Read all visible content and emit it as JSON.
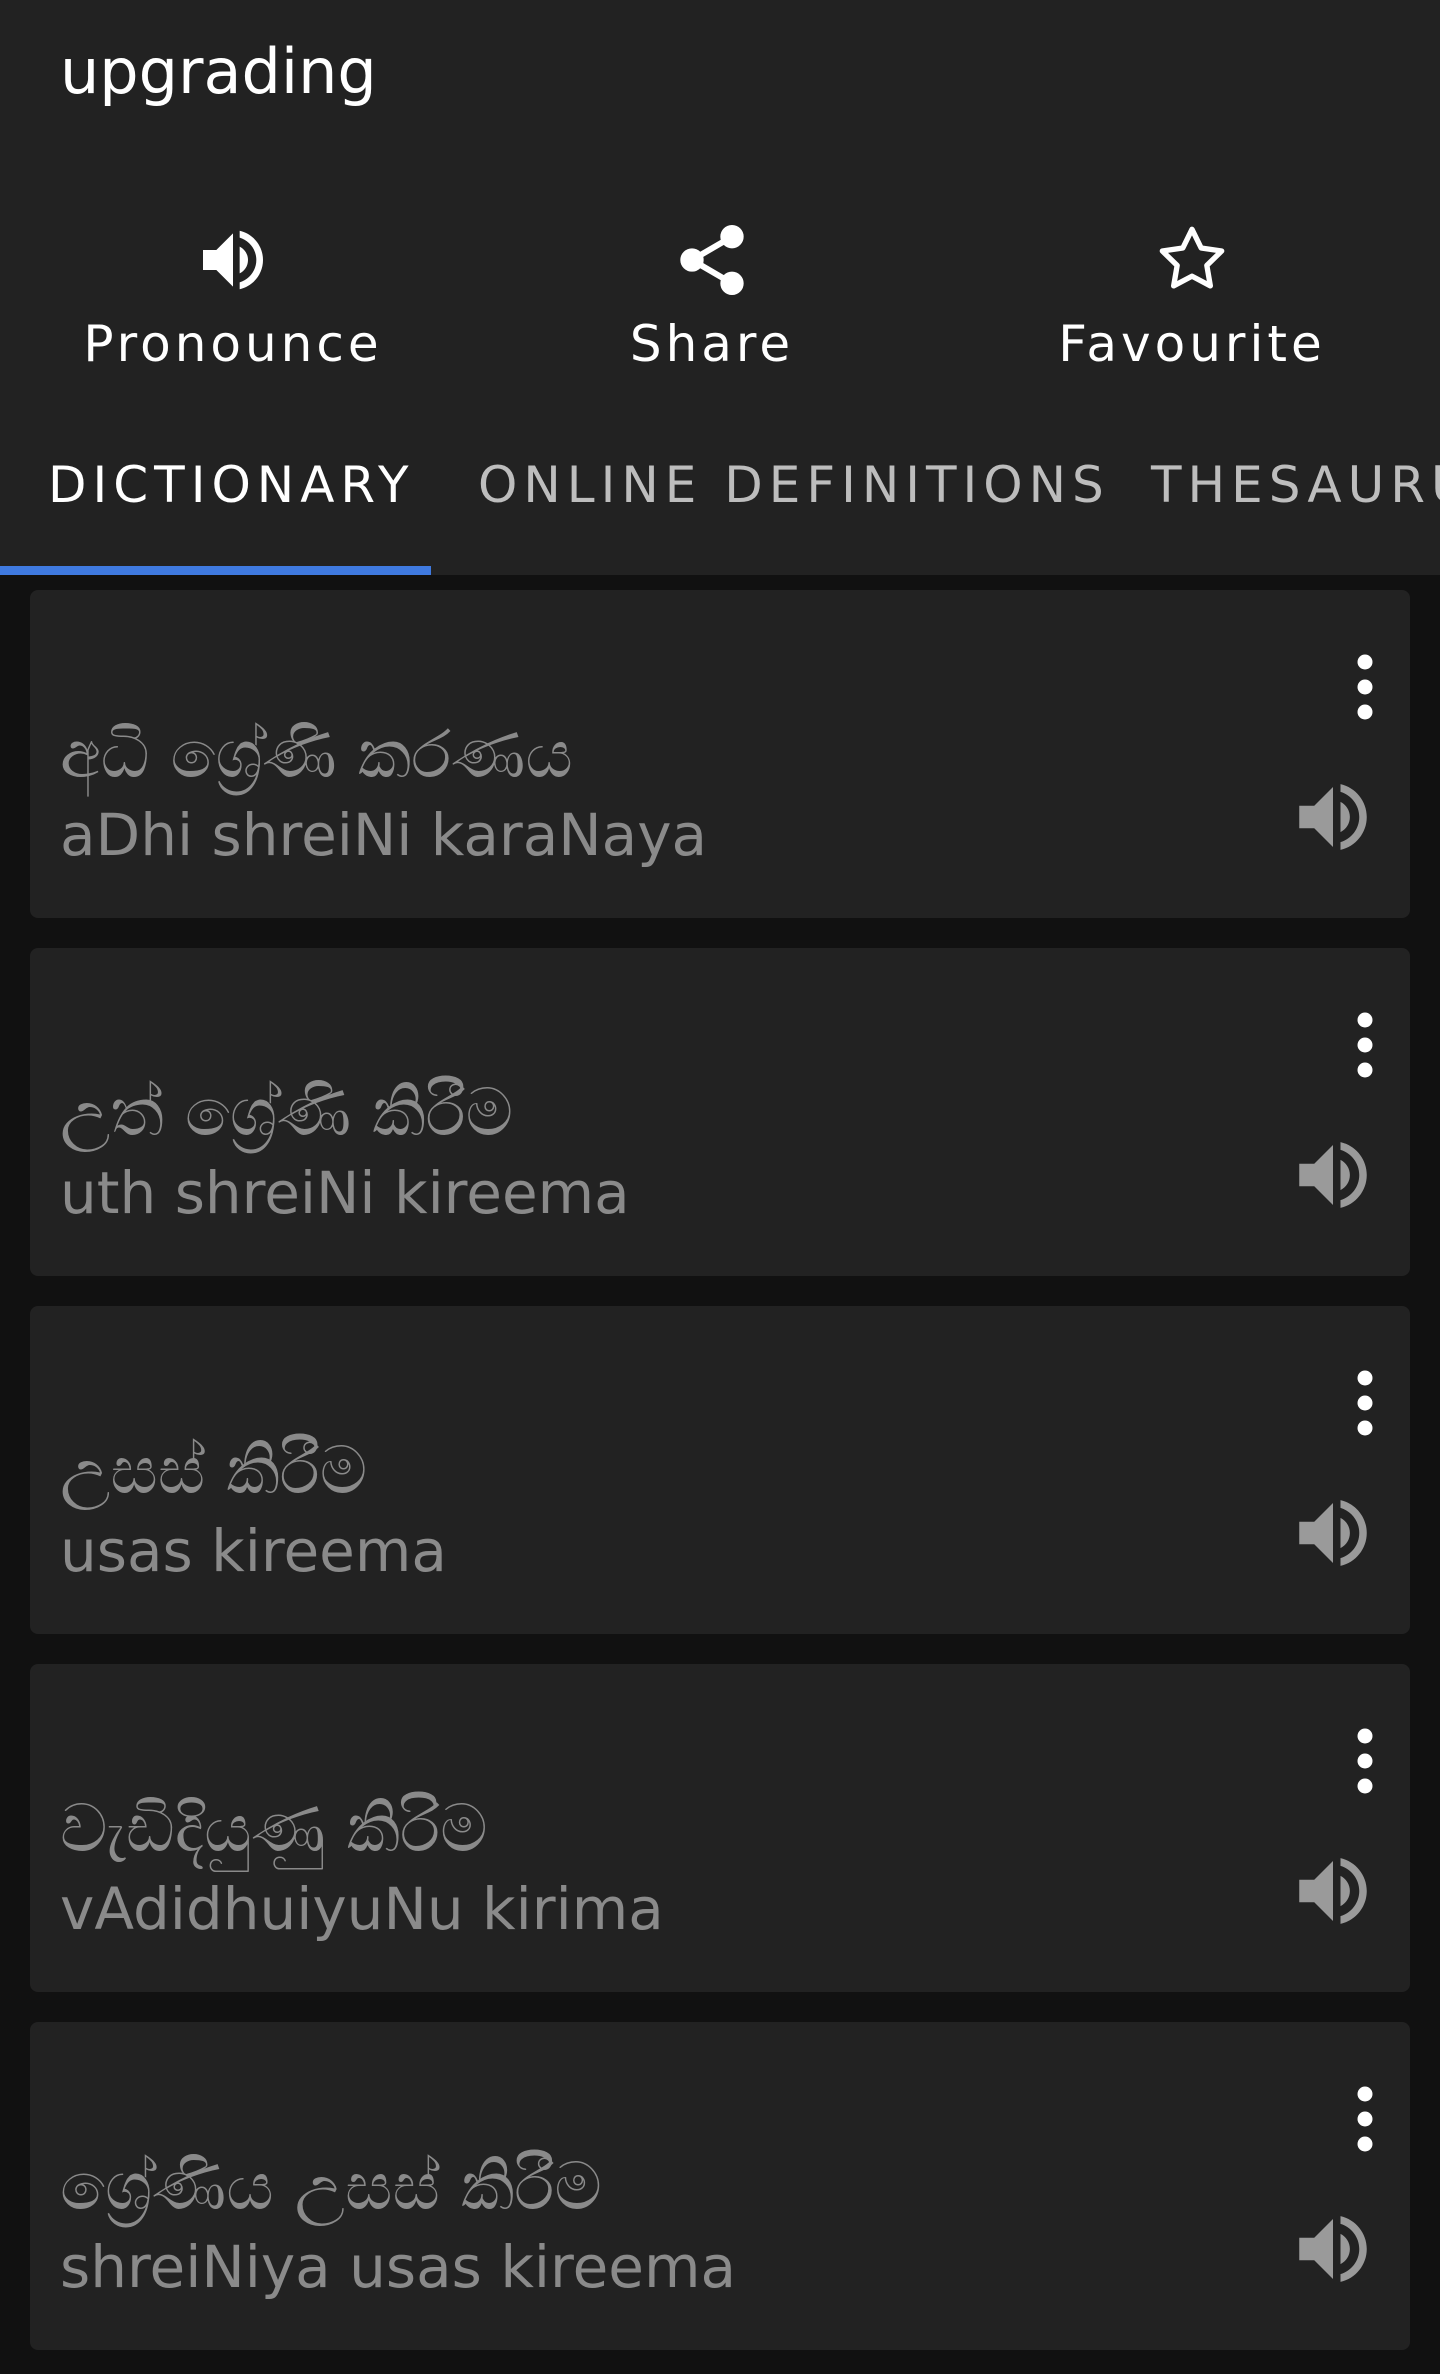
{
  "word": "upgrading",
  "actions": {
    "pronounce": "Pronounce",
    "share": "Share",
    "favourite": "Favourite"
  },
  "tabs": [
    "DICTIONARY",
    "ONLINE DEFINITIONS",
    "THESAURUS"
  ],
  "active_tab": "DICTIONARY",
  "colors": {
    "header_bg": "#222222",
    "page_bg": "#111111",
    "tab_indicator": "#3f7ae0",
    "muted_text": "#8a8a8a"
  },
  "definitions": [
    {
      "sinhala": "අධි ශ්‍රේණි කරණය",
      "roman": "aDhi shreiNi karaNaya"
    },
    {
      "sinhala": "උත් ශ්‍රේණි කිරීම",
      "roman": "uth shreiNi kireema"
    },
    {
      "sinhala": "උසස් කිරීම",
      "roman": "usas kireema"
    },
    {
      "sinhala": "වැඩිදියුණු කිරිම",
      "roman": "vAdidhuiyuNu kirima"
    },
    {
      "sinhala": "ශ්‍රේණිය උසස් කිරීම",
      "roman": "shreiNiya usas kireema"
    }
  ],
  "icons": {
    "pronounce": "speaker-icon",
    "share": "share-icon",
    "favourite": "star-outline-icon",
    "item_menu": "more-vertical-icon",
    "item_audio": "speaker-icon"
  }
}
